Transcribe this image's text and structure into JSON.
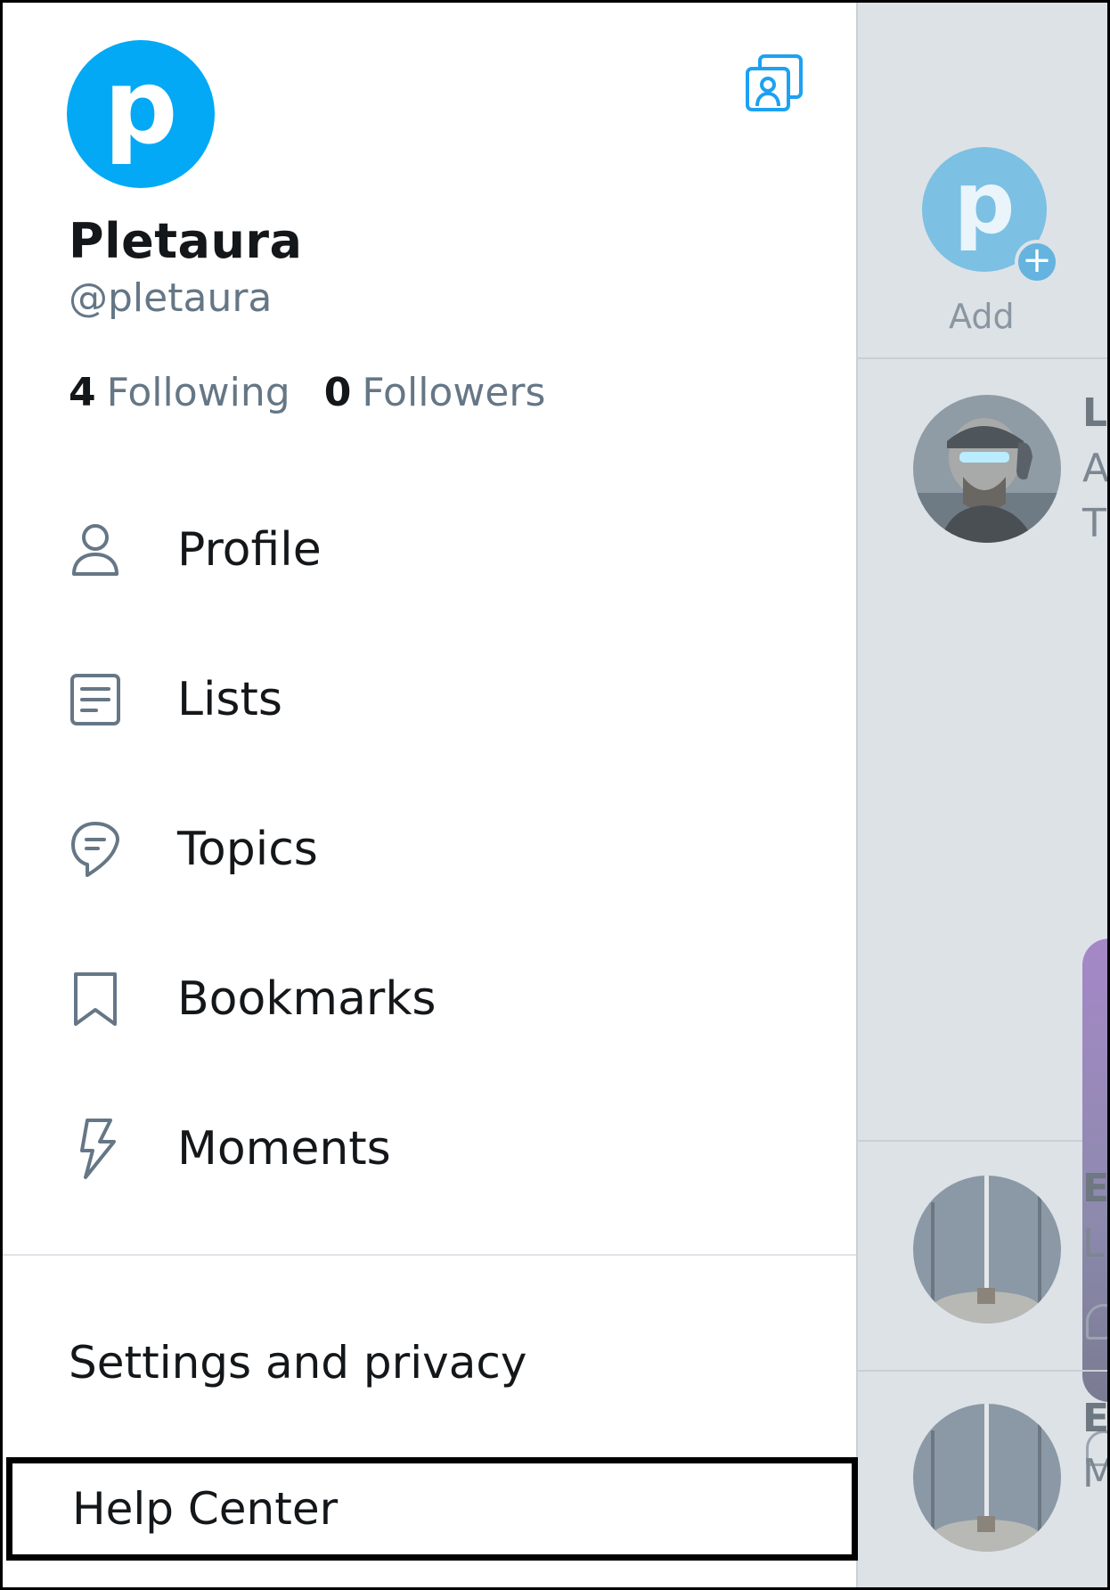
{
  "profile": {
    "avatar_letter": "p",
    "display_name": "Pletaura",
    "handle": "@pletaura",
    "following_count": "4",
    "following_label": "Following",
    "followers_count": "0",
    "followers_label": "Followers"
  },
  "menu": [
    {
      "label": "Profile",
      "icon": "person-icon"
    },
    {
      "label": "Lists",
      "icon": "list-icon"
    },
    {
      "label": "Topics",
      "icon": "topics-icon"
    },
    {
      "label": "Bookmarks",
      "icon": "bookmark-icon"
    },
    {
      "label": "Moments",
      "icon": "lightning-icon"
    }
  ],
  "bottom": {
    "settings_label": "Settings and privacy",
    "help_label": "Help Center"
  },
  "feed": {
    "fleet_letter": "p",
    "fleet_plus": "+",
    "fleet_label": "Add",
    "tweets": [
      {
        "line1": "L",
        "line2": "A",
        "line3": "T"
      },
      {
        "line1": "E",
        "line2": "L"
      },
      {
        "line1": "E",
        "line2": "M"
      }
    ]
  },
  "colors": {
    "accent": "#1da1f2",
    "avatar_bg": "#03a9f4",
    "text_primary": "#14171a",
    "text_secondary": "#657786",
    "overlay_bg": "#dde2e7"
  }
}
